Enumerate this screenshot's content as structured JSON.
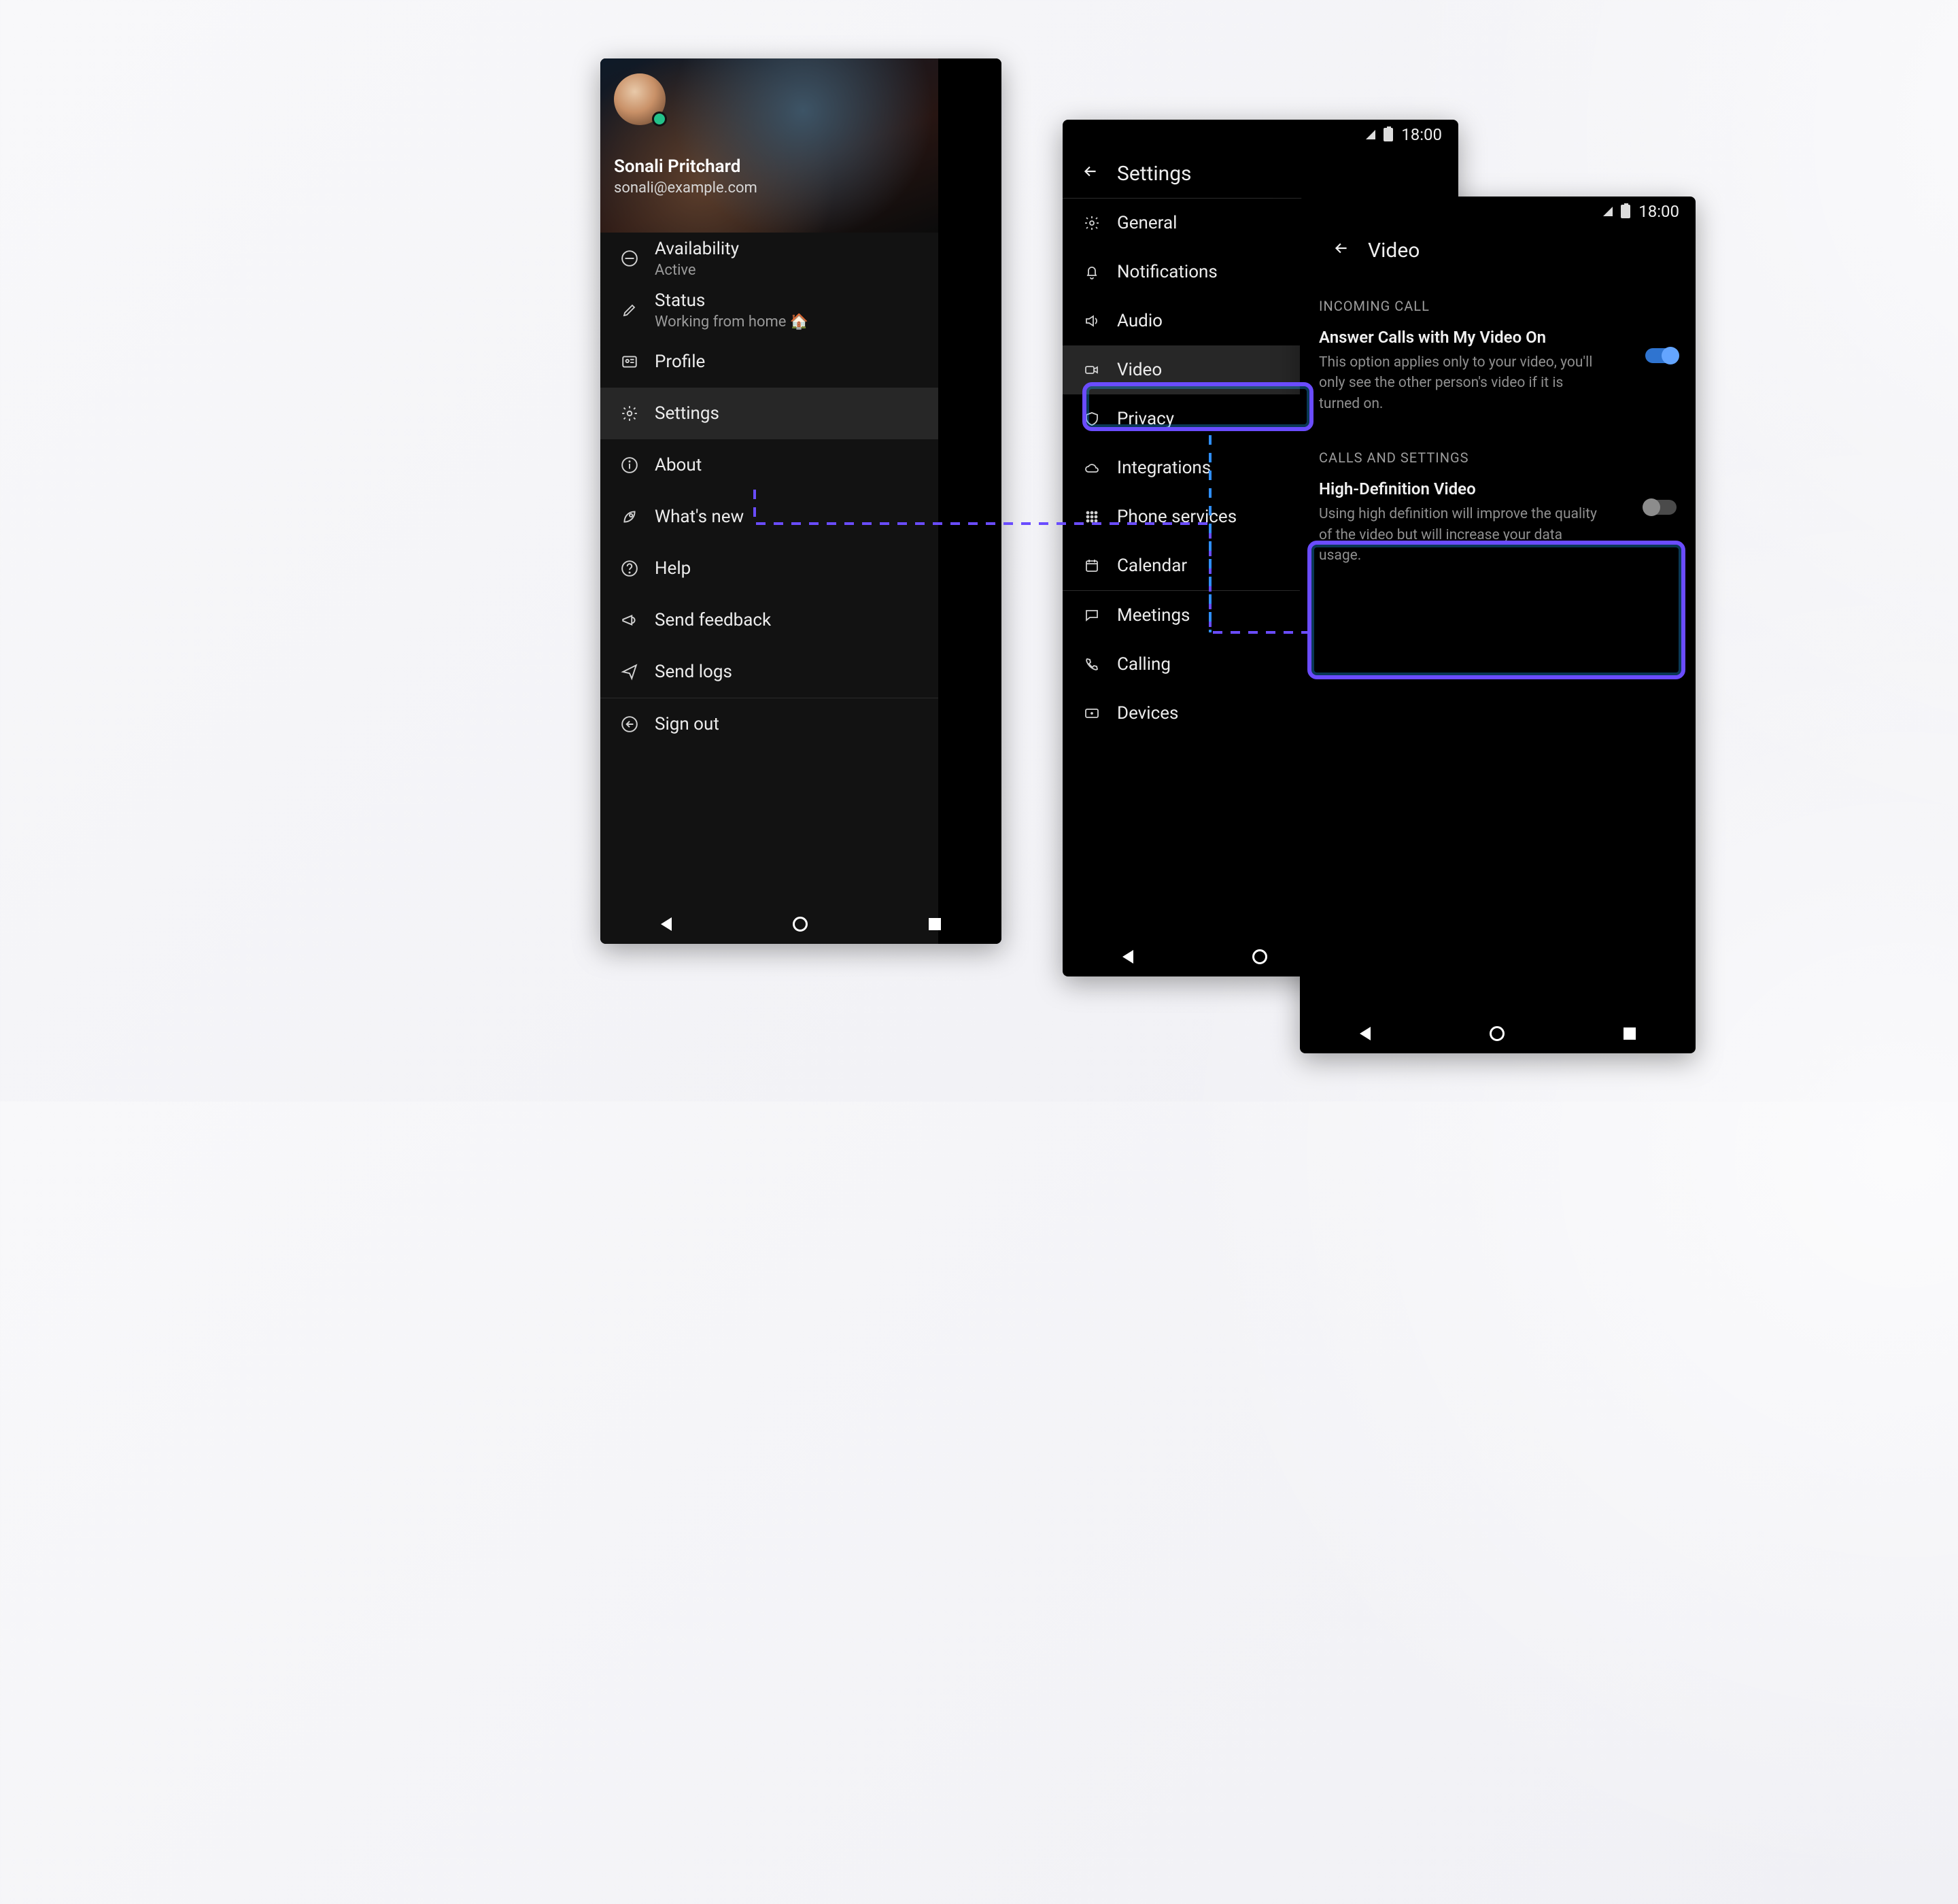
{
  "status_time": "18:00",
  "phone1": {
    "user_name": "Sonali Pritchard",
    "user_email": "sonali@example.com",
    "availability_label": "Availability",
    "availability_value": "Active",
    "status_label": "Status",
    "status_value": "Working from home 🏠",
    "items": {
      "profile": "Profile",
      "settings": "Settings",
      "about": "About",
      "whatsnew": "What's new",
      "help": "Help",
      "feedback": "Send feedback",
      "logs": "Send logs",
      "signout": "Sign out"
    }
  },
  "phone2": {
    "title": "Settings",
    "items": {
      "general": "General",
      "notifications": "Notifications",
      "audio": "Audio",
      "video": "Video",
      "privacy": "Privacy",
      "integrations": "Integrations",
      "phoneservices": "Phone services",
      "calendar": "Calendar",
      "meetings": "Meetings",
      "calling": "Calling",
      "devices": "Devices"
    }
  },
  "phone3": {
    "title": "Video",
    "section1_header": "INCOMING CALL",
    "setting1_title": "Answer Calls with My Video On",
    "setting1_desc": "This option applies only to your video, you'll only see the other person's video if it is turned on.",
    "setting1_on": true,
    "section2_header": "CALLS AND SETTINGS",
    "setting2_title": "High-Definition Video",
    "setting2_desc": "Using high definition will improve the quality of the video but will increase your data usage.",
    "setting2_on": false
  }
}
